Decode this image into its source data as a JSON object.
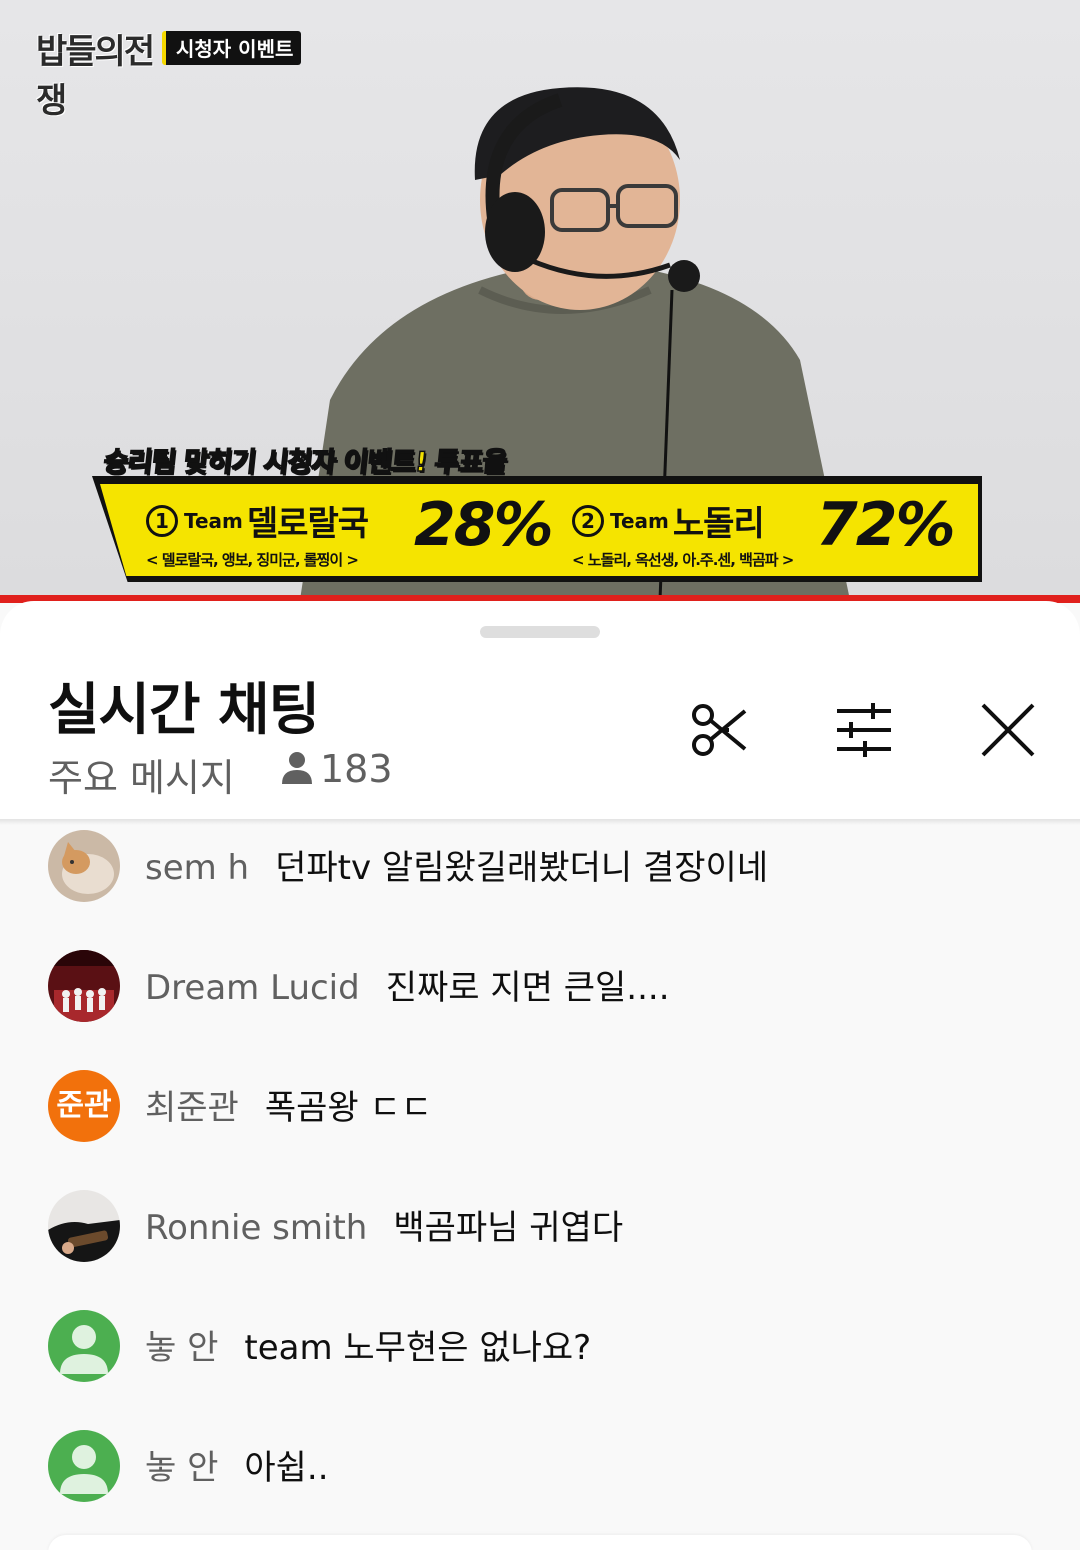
{
  "video": {
    "logo_text": "밥들의전쟁",
    "event_tag": "시청자 이벤트",
    "banner_title": "승리팀 맞히기 시청자 이벤트! 투표율",
    "teams": [
      {
        "number": "1",
        "word": "Team",
        "name": "델로랄국",
        "members": "< 델로랄국, 앵보, 징미군, 롤찡이 >",
        "percent": "28%"
      },
      {
        "number": "2",
        "word": "Team",
        "name": "노돌리",
        "members": "< 노돌리, 옥선생, 아.주.센, 백곰파 >",
        "percent": "72%"
      }
    ]
  },
  "chat": {
    "title": "실시간 채팅",
    "filter_label": "주요 메시지",
    "viewer_count": "183",
    "icons": [
      "clip-icon",
      "filter-sliders-icon",
      "close-icon"
    ],
    "messages": [
      {
        "author": "sem h",
        "text": "던파tv 알림왔길래봤더니 결장이네",
        "avatar": "cat-photo"
      },
      {
        "author": "Dream Lucid",
        "text": "진짜로 지면 큰일....",
        "avatar": "stage-photo"
      },
      {
        "author": "최준관",
        "text": "폭곰왕 ㄷㄷ",
        "avatar_initials": "준관",
        "avatar_color": "#f2710c"
      },
      {
        "author": "Ronnie smith",
        "text": "백곰파님 귀엽다",
        "avatar": "guitar-photo"
      },
      {
        "author": "놓 안",
        "text": "team 노무현은 없나요?",
        "avatar": "default-person",
        "avatar_color": "#4caf50"
      },
      {
        "author": "놓 안",
        "text": "아쉽..",
        "avatar": "default-person",
        "avatar_color": "#4caf50"
      }
    ]
  },
  "colors": {
    "accent_red": "#e0201c",
    "banner_yellow": "#f5e400",
    "avatar_green": "#4caf50",
    "avatar_orange": "#f2710c"
  }
}
